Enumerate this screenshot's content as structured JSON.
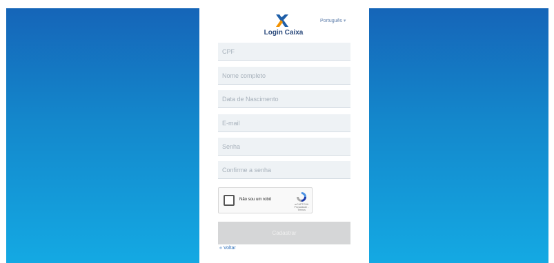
{
  "header": {
    "brand": "Login Caixa",
    "language": "Português",
    "language_chevron": "▾"
  },
  "form": {
    "fields": [
      {
        "placeholder": "CPF",
        "value": ""
      },
      {
        "placeholder": "Nome completo",
        "value": ""
      },
      {
        "placeholder": "Data de Nascimento",
        "value": ""
      },
      {
        "placeholder": "E-mail",
        "value": ""
      },
      {
        "placeholder": "Senha",
        "value": ""
      },
      {
        "placeholder": "Confirme a senha",
        "value": ""
      }
    ],
    "captcha": {
      "label": "Não sou um robô",
      "brand": "reCAPTCHA",
      "links": "Privacidade - Termos"
    },
    "submit_label": "Cadastrar",
    "back_label": "« Voltar"
  },
  "colors": {
    "gradient_top": "#1565b8",
    "gradient_bottom": "#14a9e3",
    "logo_blue": "#1f5fa8",
    "logo_orange": "#f39200"
  }
}
